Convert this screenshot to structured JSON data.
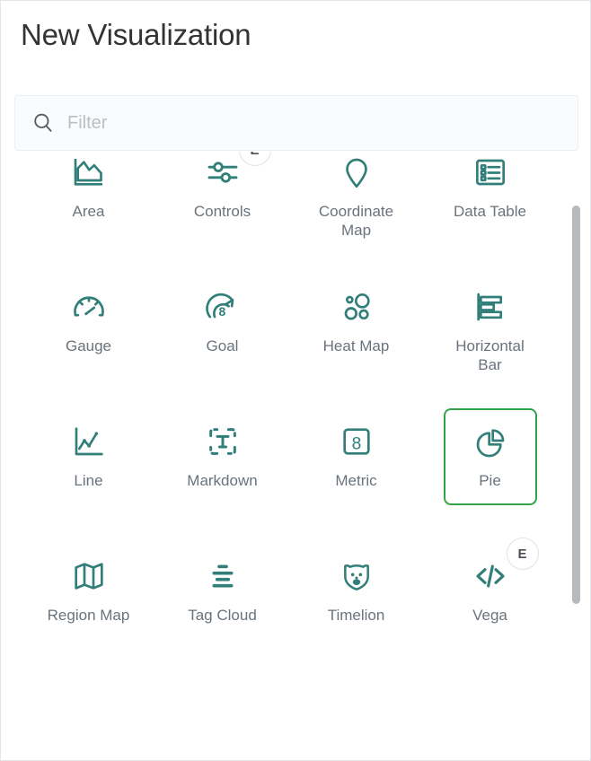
{
  "window": {
    "title": "New Visualization"
  },
  "search": {
    "placeholder": "Filter",
    "value": "",
    "icon": "search-icon"
  },
  "grid": {
    "selected_label": "Pie",
    "selection_color": "#33a34a",
    "icon_color": "#317f78",
    "items": [
      {
        "label": "Area",
        "icon": "area-chart-icon",
        "badge": "",
        "selected": false
      },
      {
        "label": "Controls",
        "icon": "controls-slider-icon",
        "badge": "E",
        "selected": false
      },
      {
        "label": "Coordinate\nMap",
        "icon": "map-marker-icon",
        "badge": "",
        "selected": false
      },
      {
        "label": "Data Table",
        "icon": "data-table-icon",
        "badge": "",
        "selected": false
      },
      {
        "label": "Gauge",
        "icon": "gauge-icon",
        "badge": "",
        "selected": false
      },
      {
        "label": "Goal",
        "icon": "goal-icon",
        "badge": "",
        "selected": false
      },
      {
        "label": "Heat Map",
        "icon": "heat-map-icon",
        "badge": "",
        "selected": false
      },
      {
        "label": "Horizontal Bar",
        "icon": "horizontal-bar-icon",
        "badge": "",
        "selected": false
      },
      {
        "label": "Line",
        "icon": "line-chart-icon",
        "badge": "",
        "selected": false
      },
      {
        "label": "Markdown",
        "icon": "markdown-text-icon",
        "badge": "",
        "selected": false
      },
      {
        "label": "Metric",
        "icon": "metric-number-icon",
        "badge": "",
        "selected": false
      },
      {
        "label": "Pie",
        "icon": "pie-chart-icon",
        "badge": "",
        "selected": true
      },
      {
        "label": "Region Map",
        "icon": "region-map-icon",
        "badge": "",
        "selected": false
      },
      {
        "label": "Tag Cloud",
        "icon": "tag-cloud-icon",
        "badge": "",
        "selected": false
      },
      {
        "label": "Timelion",
        "icon": "timelion-bear-icon",
        "badge": "",
        "selected": false
      },
      {
        "label": "Vega",
        "icon": "vega-code-icon",
        "badge": "E",
        "selected": false
      }
    ]
  },
  "scrollbar": {
    "orientation": "vertical",
    "thumb_color": "#b6babd"
  }
}
